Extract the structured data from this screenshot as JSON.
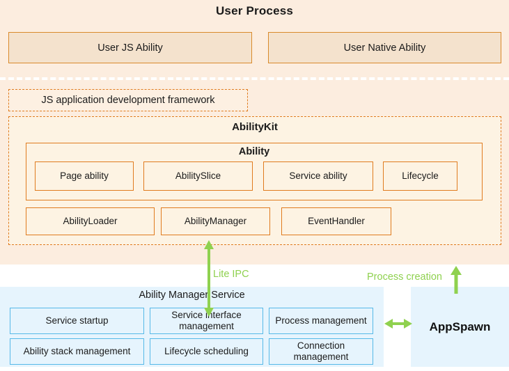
{
  "diagram": {
    "title": "User Process",
    "user_process": {
      "title": "User Process",
      "abilities": [
        {
          "label": "User JS Ability"
        },
        {
          "label": "User Native Ability"
        }
      ],
      "js_framework_label": "JS application development framework",
      "ability_kit": {
        "title": "AbilityKit",
        "ability_group": {
          "title": "Ability",
          "items": [
            {
              "label": "Page ability"
            },
            {
              "label": "AbilitySlice"
            },
            {
              "label": "Service ability"
            },
            {
              "label": "Lifecycle"
            }
          ]
        },
        "modules": [
          {
            "label": "AbilityLoader"
          },
          {
            "label": "AbilityManager"
          },
          {
            "label": "EventHandler"
          }
        ]
      }
    },
    "ability_manager_service": {
      "title": "Ability Manager Service",
      "items": [
        {
          "label": "Service startup"
        },
        {
          "label": "Service interface management"
        },
        {
          "label": "Process management"
        },
        {
          "label": "Ability stack management"
        },
        {
          "label": "Lifecycle scheduling"
        },
        {
          "label": "Connection management"
        }
      ]
    },
    "appspawn": {
      "label": "AppSpawn"
    },
    "annotations": {
      "lite_ipc": "Lite IPC",
      "process_creation": "Process creation"
    },
    "colors": {
      "user_process_bg": "#fceddf",
      "ability_box_bg": "#f4e2cd",
      "orange_border": "#d98a2b",
      "orange_dashed": "#e07b1e",
      "kit_bg": "#fdf3e3",
      "blue_panel_bg": "#e6f4fd",
      "blue_border": "#56b9e8",
      "arrow_green": "#8fd14f"
    }
  }
}
